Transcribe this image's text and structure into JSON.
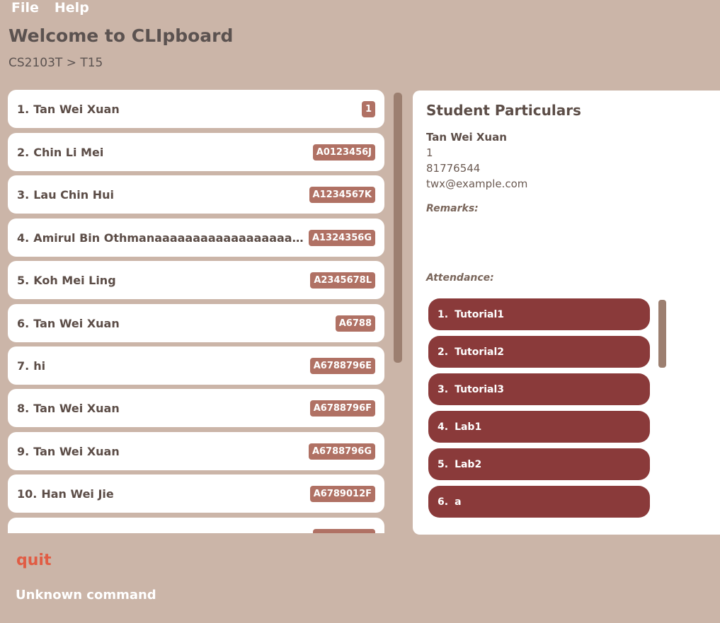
{
  "menu": {
    "file": "File",
    "help": "Help"
  },
  "header": {
    "title": "Welcome to CLIpboard",
    "breadcrumb": "CS2103T > T15"
  },
  "students": [
    {
      "index": "1.",
      "name": "Tan Wei Xuan",
      "id": "1"
    },
    {
      "index": "2.",
      "name": "Chin Li Mei",
      "id": "A0123456J"
    },
    {
      "index": "3.",
      "name": "Lau Chin Hui",
      "id": "A1234567K"
    },
    {
      "index": "4.",
      "name": "Amirul Bin Othmanaaaaaaaaaaaaaaaaaaaaaaaaaaaaaaaaaa",
      "id": "A1324356G"
    },
    {
      "index": "5.",
      "name": "Koh Mei Ling",
      "id": "A2345678L"
    },
    {
      "index": "6.",
      "name": "Tan Wei Xuan",
      "id": "A6788"
    },
    {
      "index": "7.",
      "name": "hi",
      "id": "A6788796E"
    },
    {
      "index": "8.",
      "name": "Tan Wei Xuan",
      "id": "A6788796F"
    },
    {
      "index": "9.",
      "name": "Tan Wei Xuan",
      "id": "A6788796G"
    },
    {
      "index": "10.",
      "name": "Han Wei Jie",
      "id": "A6789012F"
    }
  ],
  "details": {
    "heading": "Student Particulars",
    "name": "Tan Wei Xuan",
    "student_id": "1",
    "phone": "81776544",
    "email": "twx@example.com",
    "remarks_label": "Remarks:",
    "attendance_label": "Attendance:",
    "attendance": [
      {
        "index": "1.",
        "label": "Tutorial1"
      },
      {
        "index": "2.",
        "label": "Tutorial2"
      },
      {
        "index": "3.",
        "label": "Tutorial3"
      },
      {
        "index": "4.",
        "label": "Lab1"
      },
      {
        "index": "5.",
        "label": "Lab2"
      },
      {
        "index": "6.",
        "label": "a"
      }
    ]
  },
  "command": {
    "value": "quit",
    "result": "Unknown command"
  },
  "colors": {
    "background": "#cbb5a8",
    "badge": "#b07164",
    "attendance": "#8a3a3a",
    "command_text": "#e15c44"
  }
}
